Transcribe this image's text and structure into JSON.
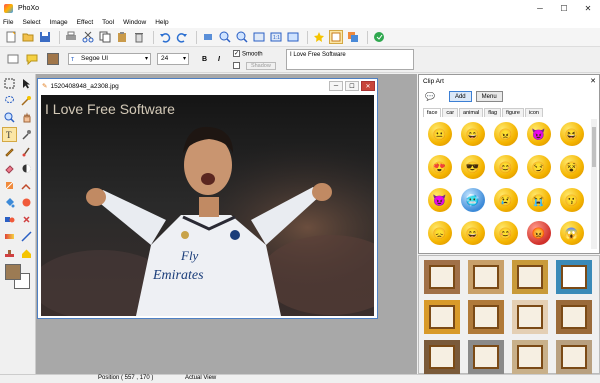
{
  "window": {
    "title": "PhoXo"
  },
  "menu": [
    "File",
    "Select",
    "Image",
    "Effect",
    "Tool",
    "Window",
    "Help"
  ],
  "toolbar_icons": [
    "new-icon",
    "open-icon",
    "save-icon",
    "print-icon",
    "cut-icon",
    "copy-icon",
    "paste-icon",
    "delete-icon",
    "undo-icon",
    "redo-icon",
    "zoom-in-icon",
    "zoom-out-icon",
    "fit-icon",
    "actual-size-icon",
    "crop-icon",
    "rotate-icon",
    "flip-icon",
    "frame-icon",
    "star-icon",
    "layer-icon",
    "mask-icon",
    "help-icon"
  ],
  "text_tools": {
    "font": "Segoe UI",
    "size": "24",
    "bold_label": "B",
    "italic_label": "I",
    "smooth_label": "Smooth",
    "shadow_label": "Shadow",
    "text_value": "I Love Free Software"
  },
  "document": {
    "filename": "1520408948_a2308.jpg",
    "overlay_text": "I Love Free Software"
  },
  "clipart": {
    "title": "Clip Art",
    "add_label": "Add",
    "menu_label": "Menu",
    "tabs": [
      "face",
      "car",
      "animal",
      "flag",
      "figure",
      "icon"
    ],
    "emoji_glyphs": [
      "😐",
      "😄",
      "😠",
      "😈",
      "😆",
      "😍",
      "😎",
      "😊",
      "😏",
      "😵",
      "😈",
      "🥶",
      "😢",
      "😭",
      "😗",
      "😞",
      "😄",
      "😊",
      "😡",
      "😱"
    ]
  },
  "colors": {
    "foreground": "#9c7b54",
    "background": "#ffffff"
  },
  "status": {
    "position": "Position ( 557 , 170 )",
    "view": "Actual View"
  }
}
